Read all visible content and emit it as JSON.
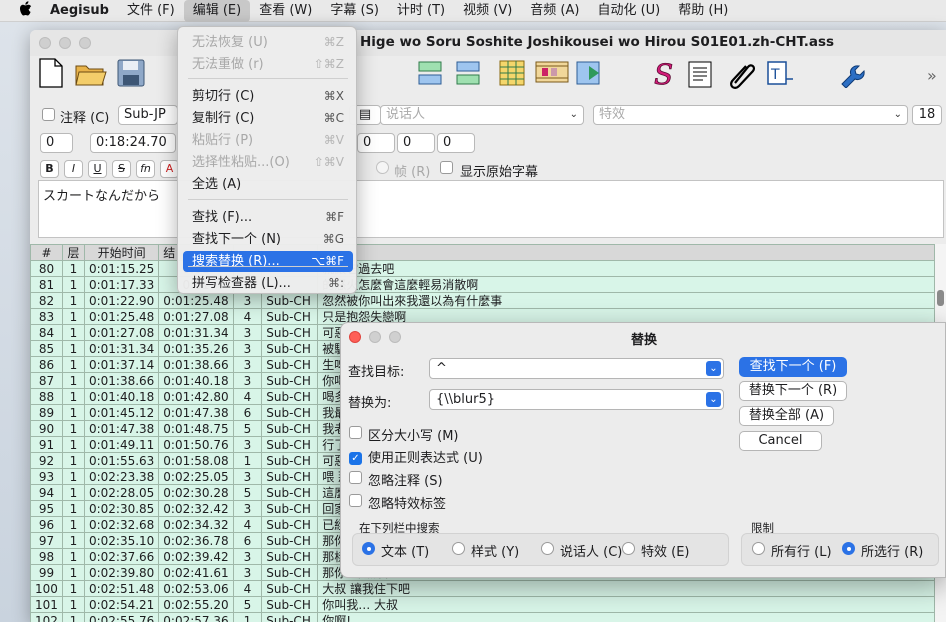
{
  "menubar": {
    "app": "Aegisub",
    "items": [
      "文件 (F)",
      "编辑 (E)",
      "查看 (W)",
      "字幕 (S)",
      "计时 (T)",
      "视频 (V)",
      "音频 (A)",
      "自动化 (U)",
      "帮助 (H)"
    ]
  },
  "window": {
    "title": "Hige wo Soru Soshite Joshikousei wo Hirou S01E01.zh-CHT.ass"
  },
  "editor": {
    "comment_label": "注释 (C)",
    "style": "Sub-JP",
    "actor_placeholder": "说话人",
    "effect_placeholder": "特效",
    "font_size": "18",
    "layer": "0",
    "start_time": "0:18:24.70",
    "margins": [
      "0",
      "0",
      "0"
    ],
    "format_buttons": [
      "B",
      "I",
      "U",
      "S",
      "fn"
    ],
    "frame_label": "帧 (R)",
    "show_original_label": "显示原始字幕",
    "text": "スカートなんだから"
  },
  "grid": {
    "headers": [
      "#",
      "层",
      "开始时间",
      "结"
    ],
    "rows": [
      [
        "80",
        "1",
        "0:01:15.25",
        "0:01",
        "",
        "",
        "就讓它過去吧"
      ],
      [
        "81",
        "1",
        "0:01:17.33",
        "0:01",
        "",
        "",
        "的怒火怎麼會這麼輕易消散啊"
      ],
      [
        "82",
        "1",
        "0:01:22.90",
        "0:01:25.48",
        "3",
        "Sub-CH",
        "忽然被你叫出來我還以為有什麼事"
      ],
      [
        "83",
        "1",
        "0:01:25.48",
        "0:01:27.08",
        "4",
        "Sub-CH",
        "只是抱怨失戀啊"
      ],
      [
        "84",
        "1",
        "0:01:27.08",
        "0:01:31.34",
        "3",
        "Sub-CH",
        "可惡"
      ],
      [
        "85",
        "1",
        "0:01:31.34",
        "0:01:35.26",
        "3",
        "Sub-CH",
        "被騙"
      ],
      [
        "86",
        "1",
        "0:01:37.14",
        "0:01:38.66",
        "3",
        "Sub-CH",
        "生啤"
      ],
      [
        "87",
        "1",
        "0:01:38.66",
        "0:01:40.18",
        "3",
        "Sub-CH",
        "你喝"
      ],
      [
        "88",
        "1",
        "0:01:40.18",
        "0:01:42.80",
        "4",
        "Sub-CH",
        "喝多"
      ],
      [
        "89",
        "1",
        "0:01:45.12",
        "0:01:47.38",
        "6",
        "Sub-CH",
        "我最"
      ],
      [
        "90",
        "1",
        "0:01:47.38",
        "0:01:48.75",
        "5",
        "Sub-CH",
        "我老"
      ],
      [
        "91",
        "1",
        "0:01:49.11",
        "0:01:50.76",
        "3",
        "Sub-CH",
        "行了"
      ],
      [
        "92",
        "1",
        "0:01:55.63",
        "0:01:58.08",
        "1",
        "Sub-CH",
        "可惡"
      ],
      [
        "93",
        "1",
        "0:02:23.38",
        "0:02:25.05",
        "3",
        "Sub-CH",
        "喂 那"
      ],
      [
        "94",
        "1",
        "0:02:28.05",
        "0:02:30.28",
        "5",
        "Sub-CH",
        "這麼"
      ],
      [
        "95",
        "1",
        "0:02:30.85",
        "0:02:32.42",
        "3",
        "Sub-CH",
        "回家"
      ],
      [
        "96",
        "1",
        "0:02:32.68",
        "0:02:34.32",
        "4",
        "Sub-CH",
        "已經"
      ],
      [
        "97",
        "1",
        "0:02:35.10",
        "0:02:36.78",
        "6",
        "Sub-CH",
        "那你"
      ],
      [
        "98",
        "1",
        "0:02:37.66",
        "0:02:39.42",
        "3",
        "Sub-CH",
        "那樣"
      ],
      [
        "99",
        "1",
        "0:02:39.80",
        "0:02:41.61",
        "3",
        "Sub-CH",
        "那你怎麼辦啊"
      ],
      [
        "100",
        "1",
        "0:02:51.48",
        "0:02:53.06",
        "4",
        "Sub-CH",
        "大叔 讓我住下吧"
      ],
      [
        "101",
        "1",
        "0:02:54.21",
        "0:02:55.20",
        "5",
        "Sub-CH",
        "你叫我… 大叔"
      ],
      [
        "102",
        "1",
        "0:02:55.76",
        "0:02:57.36",
        "1",
        "Sub-CH",
        "你啊!"
      ]
    ]
  },
  "edit_menu": {
    "items": [
      {
        "label": "无法恢复 (U)",
        "shortcut": "⌘Z",
        "disabled": true
      },
      {
        "label": "无法重做 (r)",
        "shortcut": "⇧⌘Z",
        "disabled": true
      },
      {
        "label": "剪切行 (C)",
        "shortcut": "⌘X",
        "disabled": false
      },
      {
        "label": "复制行 (C)",
        "shortcut": "⌘C",
        "disabled": false
      },
      {
        "label": "粘贴行 (P)",
        "shortcut": "⌘V",
        "disabled": true
      },
      {
        "label": "选择性粘贴...(O)",
        "shortcut": "⇧⌘V",
        "disabled": true
      },
      {
        "label": "全选 (A)",
        "shortcut": "",
        "disabled": false
      },
      {
        "label": "查找 (F)...",
        "shortcut": "⌘F",
        "disabled": false
      },
      {
        "label": "查找下一个 (N)",
        "shortcut": "⌘G",
        "disabled": false
      },
      {
        "label": "搜索替换 (R)...",
        "shortcut": "⌥⌘F",
        "disabled": false,
        "highlighted": true
      },
      {
        "label": "拼写检查器 (L)...",
        "shortcut": "⌘:",
        "disabled": false
      }
    ]
  },
  "replace_dialog": {
    "title": "替换",
    "find_label": "查找目标:",
    "find_value": "^",
    "replace_label": "替换为:",
    "replace_value": "{\\\\blur5}",
    "find_next": "查找下一个 (F)",
    "replace_next": "替换下一个 (R)",
    "replace_all": "替换全部 (A)",
    "cancel": "Cancel",
    "options": [
      {
        "label": "区分大小写 (M)",
        "checked": false
      },
      {
        "label": "使用正则表达式 (U)",
        "checked": true
      },
      {
        "label": "忽略注释 (S)",
        "checked": false
      },
      {
        "label": "忽略特效标签",
        "checked": false
      }
    ],
    "search_in_label": "在下列栏中搜索",
    "search_in": [
      {
        "label": "文本 (T)",
        "selected": true
      },
      {
        "label": "样式 (Y)",
        "selected": false
      },
      {
        "label": "说话人 (C)",
        "selected": false
      },
      {
        "label": "特效 (E)",
        "selected": false
      }
    ],
    "limit_label": "限制",
    "limit": [
      {
        "label": "所有行 (L)",
        "selected": false
      },
      {
        "label": "所选行 (R)",
        "selected": true
      }
    ]
  }
}
